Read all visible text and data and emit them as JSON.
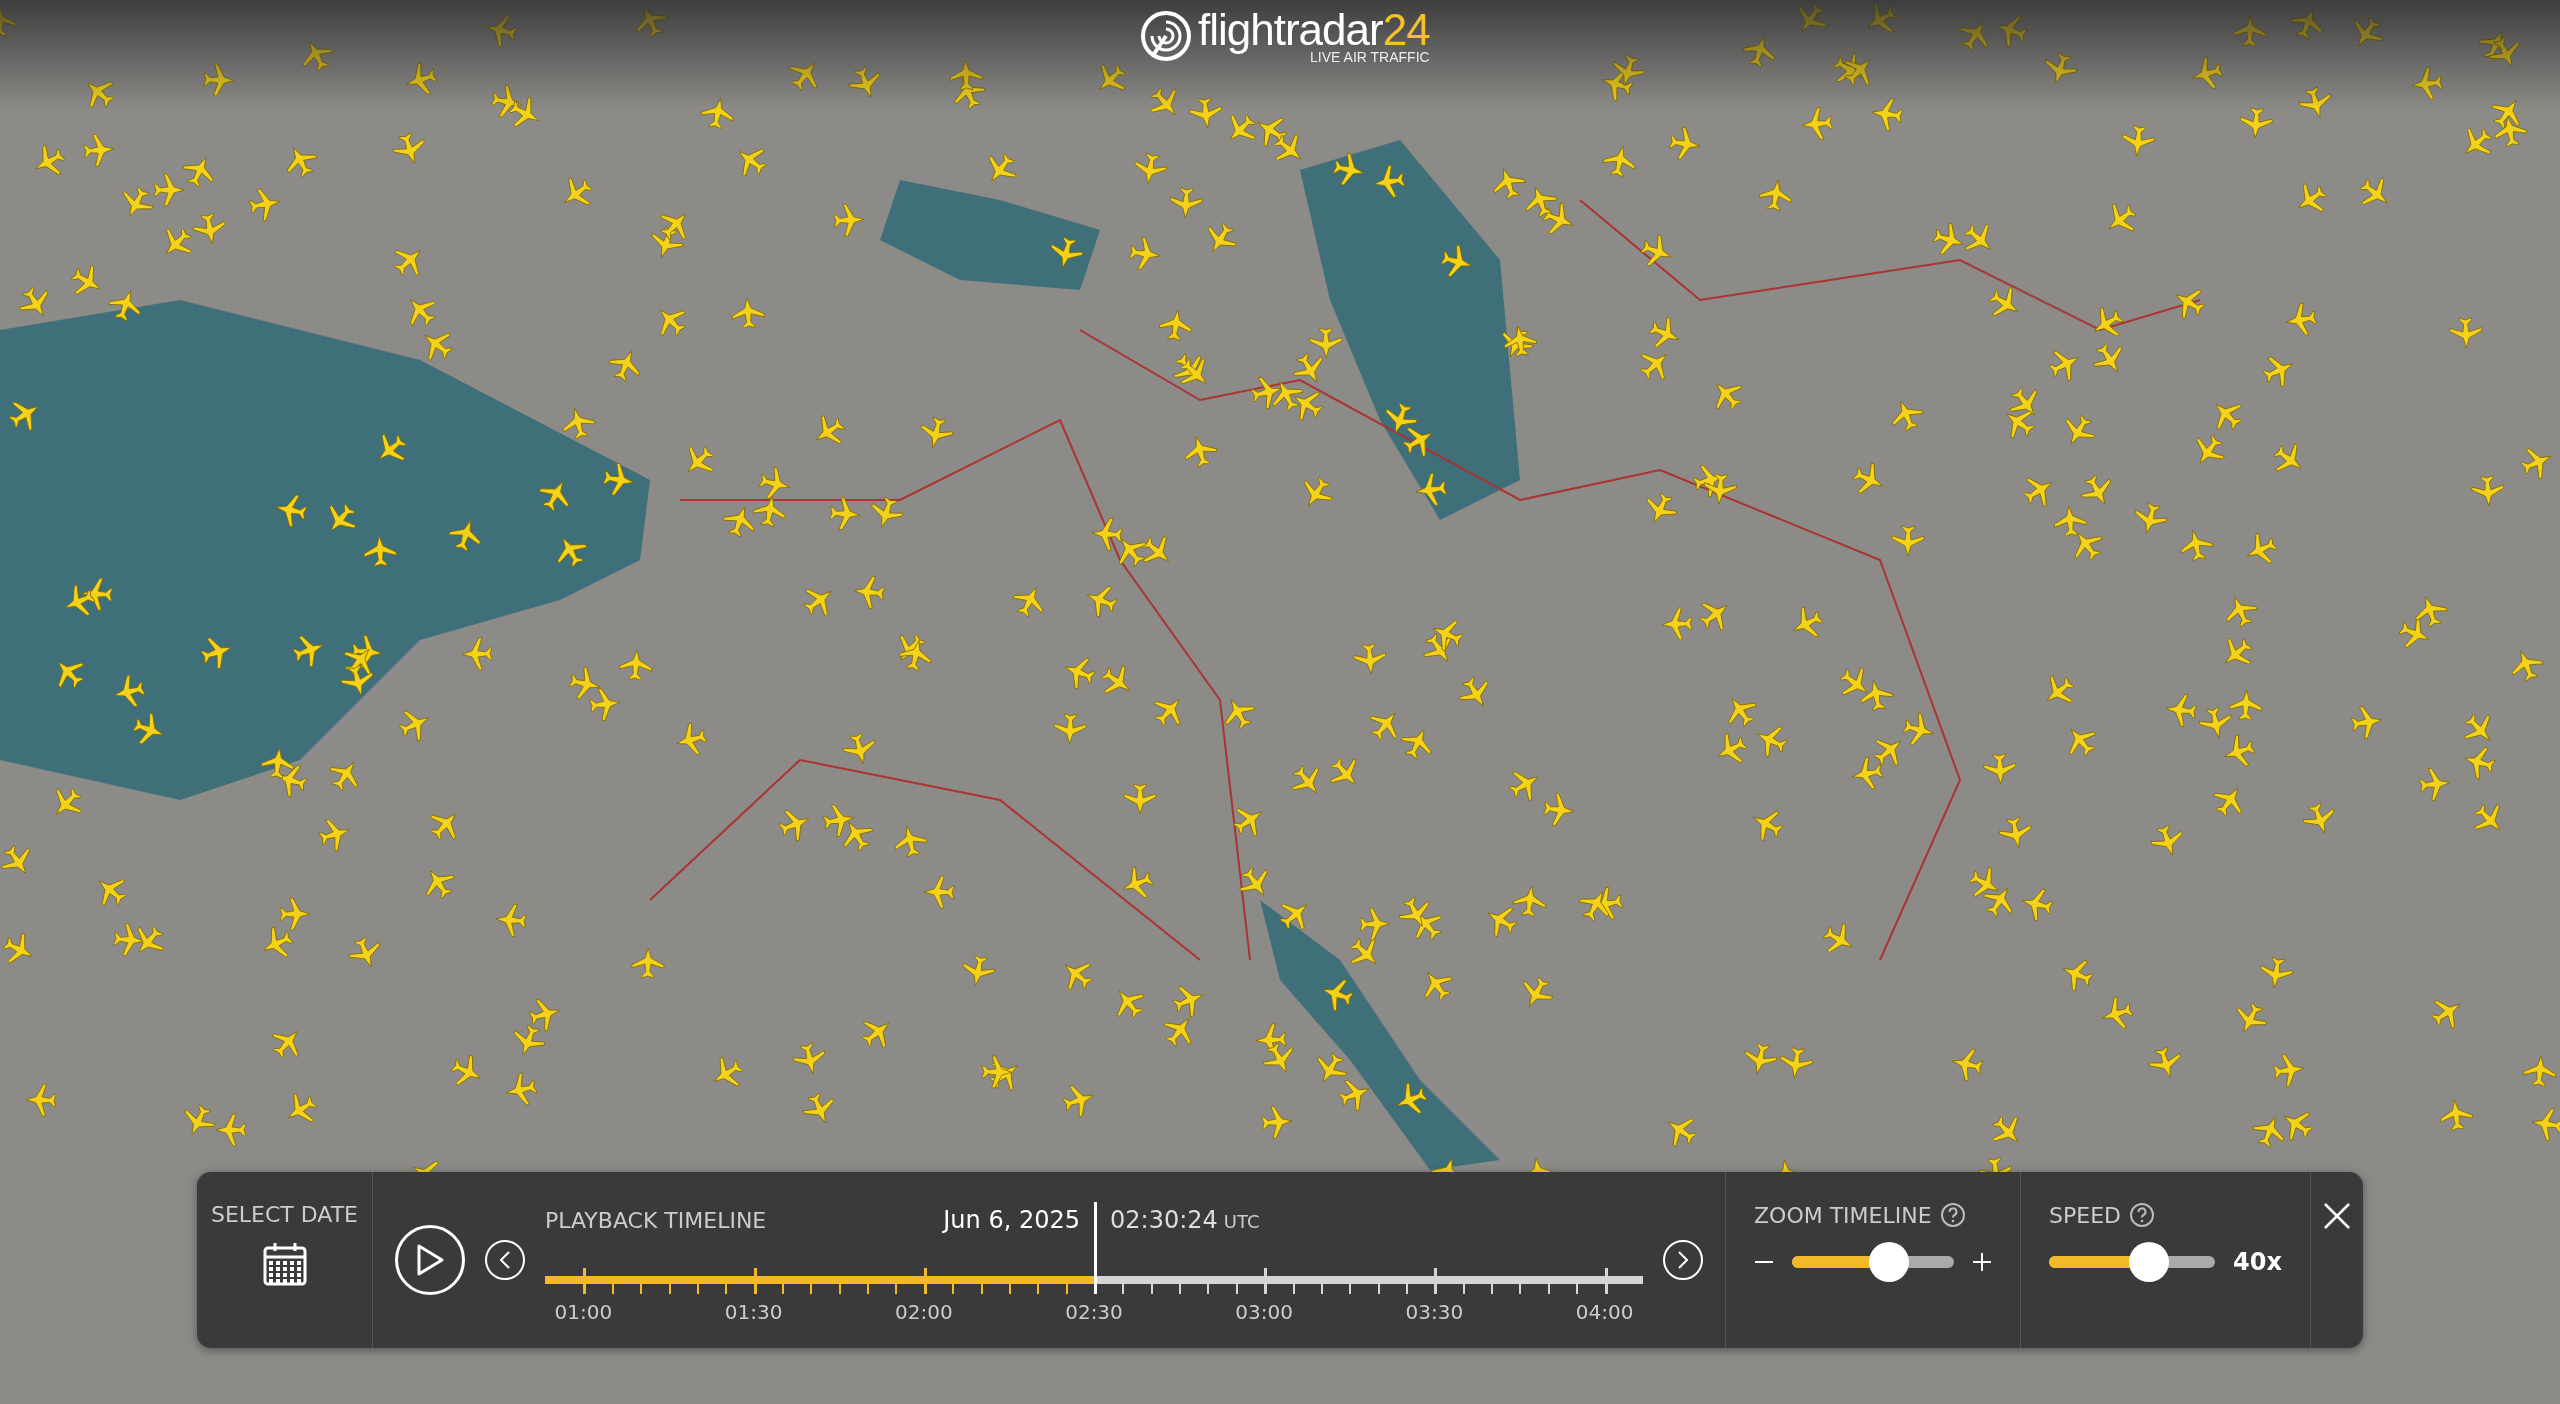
{
  "logo": {
    "name": "flightradar",
    "suffix": "24",
    "tagline": "LIVE AIR TRAFFIC"
  },
  "select_date": {
    "label": "SELECT DATE"
  },
  "playback": {
    "title": "PLAYBACK TIMELINE",
    "date": "Jun 6, 2025",
    "time": "02:30:24",
    "time_zone": "UTC",
    "level": 0.5,
    "ticks": [
      "01:00",
      "01:30",
      "02:00",
      "02:30",
      "03:00",
      "03:30",
      "04:00"
    ]
  },
  "zoom_timeline": {
    "label": "ZOOM TIMELINE",
    "level": 0.6
  },
  "speed": {
    "label": "SPEED",
    "level": 0.6,
    "reading": "40x"
  }
}
